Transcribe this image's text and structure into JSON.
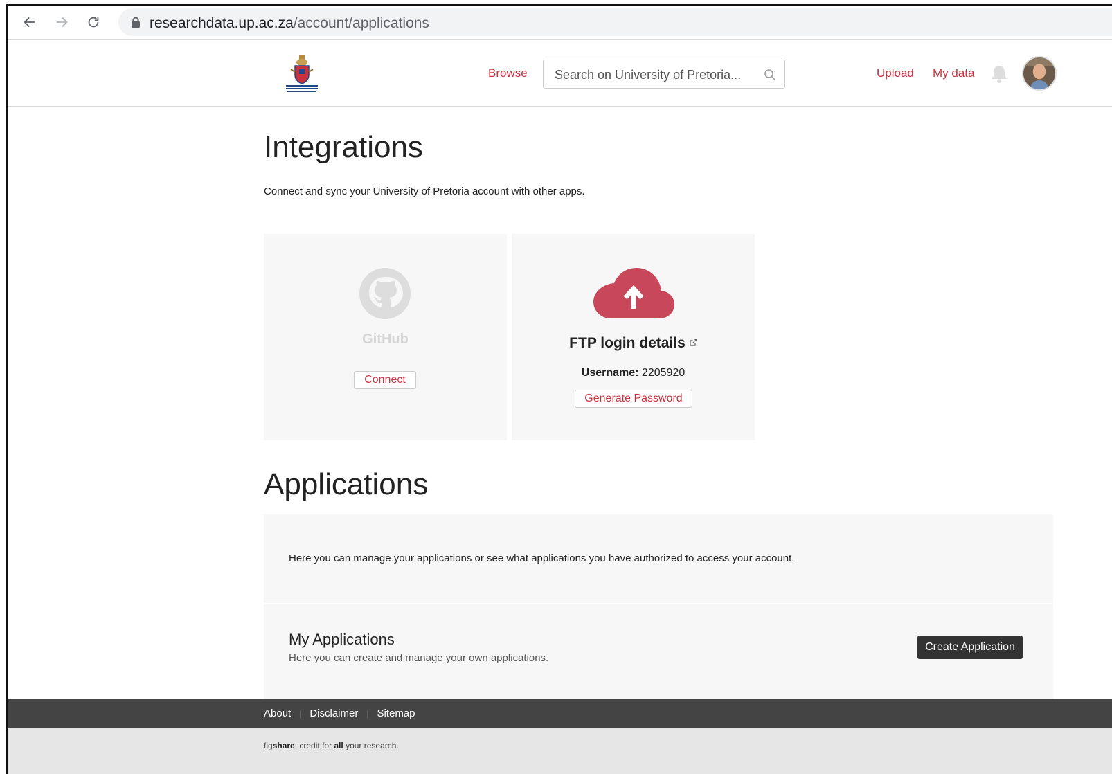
{
  "browser": {
    "url_host": "researchdata.up.ac.za",
    "url_path": "/account/applications"
  },
  "header": {
    "logo_icon": "university-of-pretoria-crest",
    "browse": "Browse",
    "search_placeholder": "Search on University of Pretoria...",
    "upload": "Upload",
    "my_data": "My data",
    "accent": "#c8323f"
  },
  "integrations": {
    "title": "Integrations",
    "intro": "Connect and sync your University of Pretoria account with other apps.",
    "github": {
      "name": "GitHub",
      "connect": "Connect"
    },
    "ftp": {
      "title": "FTP login details",
      "username_label": "Username:",
      "username_value": "2205920",
      "generate": "Generate Password"
    }
  },
  "applications": {
    "title": "Applications",
    "description": "Here you can manage your applications or see what applications you have authorized to access your account.",
    "my_apps_title": "My Applications",
    "my_apps_sub": "Here you can create and manage your own applications.",
    "create": "Create Application"
  },
  "footer": {
    "links": [
      "About",
      "Disclaimer",
      "Sitemap"
    ],
    "credit_fig": "fig",
    "credit_share": "share",
    "credit_mid": ". credit for ",
    "credit_all": "all",
    "credit_end": " your research."
  }
}
